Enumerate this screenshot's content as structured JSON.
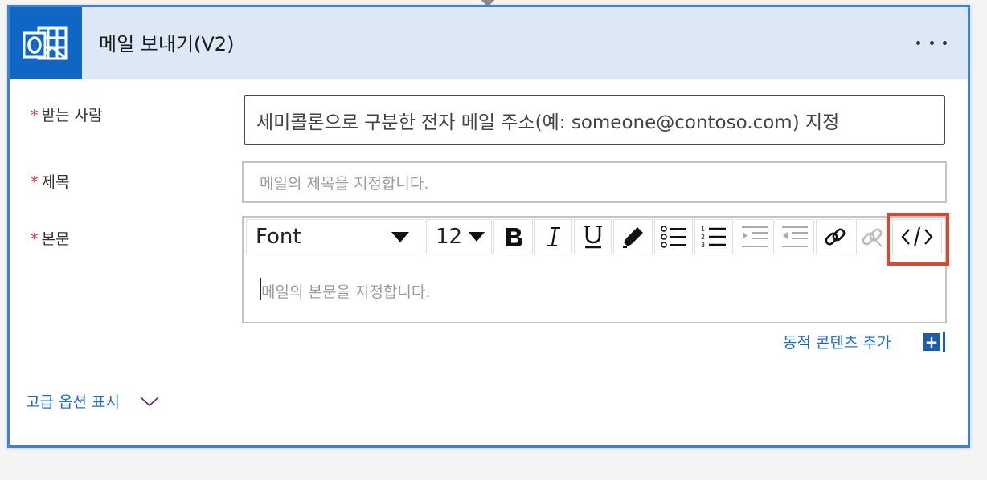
{
  "card": {
    "title": "메일 보내기(V2)",
    "app_icon": "outlook-icon",
    "more_icon": "more-icon"
  },
  "fields": {
    "to": {
      "required_mark": "*",
      "label": "받는 사람",
      "placeholder": "세미콜론으로 구분한 전자 메일 주소(예: someone@contoso.com) 지정"
    },
    "subject": {
      "required_mark": "*",
      "label": "제목",
      "placeholder": "메일의 제목을 지정합니다."
    },
    "body": {
      "required_mark": "*",
      "label": "본문",
      "placeholder": "메일의 본문을 지정합니다."
    }
  },
  "toolbar": {
    "font_label": "Font",
    "size_label": "12",
    "buttons": [
      "bold-icon",
      "italic-icon",
      "underline-icon",
      "highlight-pen-icon",
      "bulleted-list-icon",
      "numbered-list-icon",
      "decrease-indent-icon",
      "increase-indent-icon",
      "link-icon",
      "unlink-icon",
      "code-view-icon"
    ]
  },
  "dynamic_content": {
    "label": "동적 콘텐츠 추가",
    "plus": "+"
  },
  "advanced": {
    "label": "고급 옵션 표시"
  },
  "colors": {
    "accent": "#3b82d6",
    "header_bg": "#dce8f6",
    "outlook_blue": "#0f66c4",
    "required": "#d13438",
    "link": "#1e6fc4",
    "highlight": "#e0452f"
  }
}
